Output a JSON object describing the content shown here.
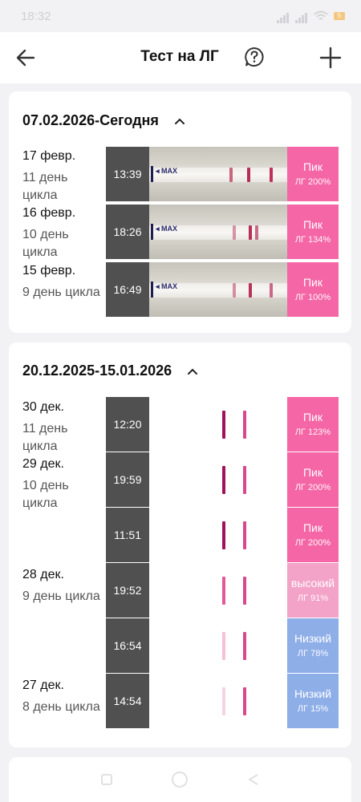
{
  "status": {
    "time": "18:32",
    "battery": "5"
  },
  "header": {
    "title": "Тест на ЛГ"
  },
  "colors": {
    "peak": "#f566a6",
    "high": "#f3a3c8",
    "low": "#8eaee8",
    "time_bg": "#505050",
    "line_dark": "#a0135c",
    "line_mid": "#d8488c",
    "line_light": "#f4c1d6"
  },
  "groups": [
    {
      "title": "07.02.2026-Сегодня",
      "days": [
        {
          "date": "17 февр.",
          "cycle_day": "11 день цикла"
        },
        {
          "date": "16 февр.",
          "cycle_day": "10 день цикла"
        },
        {
          "date": "15 февр.",
          "cycle_day": "9 день цикла"
        }
      ],
      "tests": [
        {
          "time": "13:39",
          "max_label": "MAX",
          "result": "Пик",
          "lh": "ЛГ 200%",
          "level": "peak"
        },
        {
          "time": "18:26",
          "max_label": "MAX",
          "result": "Пик",
          "lh": "ЛГ 134%",
          "level": "peak"
        },
        {
          "time": "16:49",
          "max_label": "MAX",
          "result": "Пик",
          "lh": "ЛГ 100%",
          "level": "peak"
        }
      ]
    },
    {
      "title": "20.12.2025-15.01.2026",
      "days": [
        {
          "date": "30 дек.",
          "cycle_day": "11 день цикла"
        },
        {
          "date": "29 дек.",
          "cycle_day": "10 день цикла"
        },
        {
          "date": "28 дек.",
          "cycle_day": "9 день цикла"
        },
        {
          "date": "27 дек.",
          "cycle_day": "8 день цикла"
        }
      ],
      "tests": [
        {
          "time": "12:20",
          "result": "Пик",
          "lh": "ЛГ 123%",
          "level": "peak"
        },
        {
          "time": "19:59",
          "result": "Пик",
          "lh": "ЛГ 200%",
          "level": "peak"
        },
        {
          "time": "11:51",
          "result": "Пик",
          "lh": "ЛГ 200%",
          "level": "peak"
        },
        {
          "time": "19:52",
          "result": "высокий",
          "lh": "ЛГ 91%",
          "level": "high"
        },
        {
          "time": "16:54",
          "result": "Низкий",
          "lh": "ЛГ 78%",
          "level": "low"
        },
        {
          "time": "14:54",
          "result": "Низкий",
          "lh": "ЛГ 15%",
          "level": "low"
        }
      ]
    }
  ]
}
